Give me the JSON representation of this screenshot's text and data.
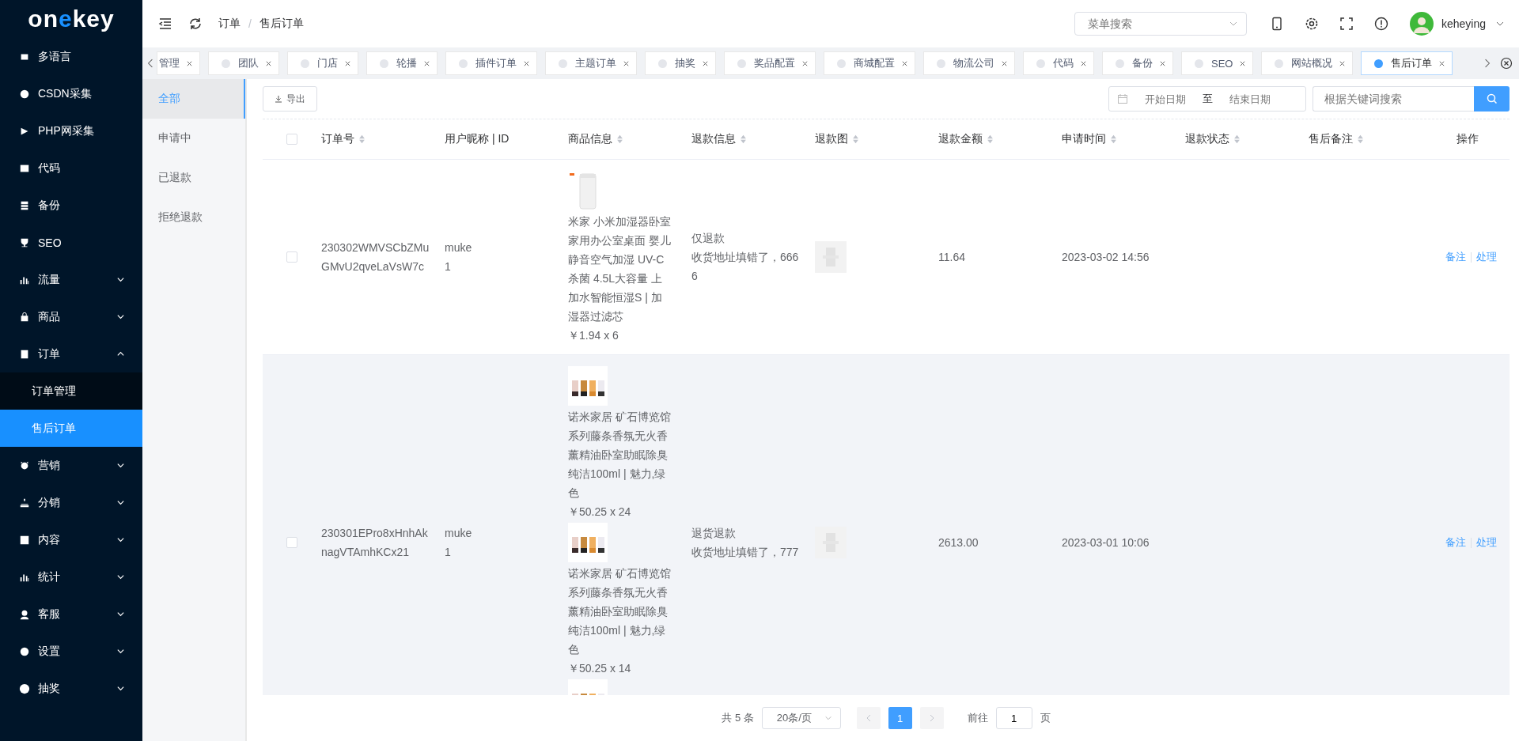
{
  "logo": {
    "text_before": "o",
    "text_mark": "n",
    "text_accent": "e",
    "text_after": "key"
  },
  "sidebar": {
    "items": [
      {
        "label": "多语言",
        "has_arrow": false,
        "selected": false
      },
      {
        "label": "CSDN采集",
        "has_arrow": false,
        "selected": false
      },
      {
        "label": "PHP网采集",
        "has_arrow": false,
        "selected": false
      },
      {
        "label": "代码",
        "has_arrow": false,
        "selected": false
      },
      {
        "label": "备份",
        "has_arrow": false,
        "selected": false
      },
      {
        "label": "SEO",
        "has_arrow": false,
        "selected": false
      },
      {
        "label": "流量",
        "has_arrow": true,
        "expanded": false,
        "selected": false
      },
      {
        "label": "商品",
        "has_arrow": true,
        "expanded": false,
        "selected": false
      },
      {
        "label": "订单",
        "has_arrow": true,
        "expanded": true,
        "selected": false,
        "children": [
          {
            "label": "订单管理",
            "selected": false
          },
          {
            "label": "售后订单",
            "selected": true
          }
        ]
      },
      {
        "label": "营销",
        "has_arrow": true,
        "expanded": false,
        "selected": false
      },
      {
        "label": "分销",
        "has_arrow": true,
        "expanded": false,
        "selected": false
      },
      {
        "label": "内容",
        "has_arrow": true,
        "expanded": false,
        "selected": false
      },
      {
        "label": "统计",
        "has_arrow": true,
        "expanded": false,
        "selected": false
      },
      {
        "label": "客服",
        "has_arrow": true,
        "expanded": false,
        "selected": false
      },
      {
        "label": "设置",
        "has_arrow": true,
        "expanded": false,
        "selected": false
      },
      {
        "label": "抽奖",
        "has_arrow": true,
        "expanded": false,
        "selected": false
      }
    ]
  },
  "header": {
    "breadcrumb": [
      "订单",
      "售后订单"
    ],
    "breadcrumb_separator": "/",
    "menu_search": {
      "placeholder": "菜单搜索"
    },
    "username": "keheying"
  },
  "tabs": [
    {
      "label": "管理",
      "dot": false,
      "selected": false
    },
    {
      "label": "团队",
      "dot": true,
      "selected": false
    },
    {
      "label": "门店",
      "dot": true,
      "selected": false
    },
    {
      "label": "轮播",
      "dot": true,
      "selected": false
    },
    {
      "label": "插件订单",
      "dot": true,
      "selected": false
    },
    {
      "label": "主题订单",
      "dot": true,
      "selected": false
    },
    {
      "label": "抽奖",
      "dot": true,
      "selected": false
    },
    {
      "label": "奖品配置",
      "dot": true,
      "selected": false
    },
    {
      "label": "商城配置",
      "dot": true,
      "selected": false
    },
    {
      "label": "物流公司",
      "dot": true,
      "selected": false
    },
    {
      "label": "代码",
      "dot": true,
      "selected": false
    },
    {
      "label": "备份",
      "dot": true,
      "selected": false
    },
    {
      "label": "SEO",
      "dot": true,
      "selected": false
    },
    {
      "label": "网站概况",
      "dot": true,
      "selected": false
    },
    {
      "label": "售后订单",
      "dot": true,
      "selected": true
    }
  ],
  "status_filter": [
    {
      "label": "全部",
      "selected": true
    },
    {
      "label": "申请中",
      "selected": false
    },
    {
      "label": "已退款",
      "selected": false
    },
    {
      "label": "拒绝退款",
      "selected": false
    }
  ],
  "toolbar": {
    "export_button": "导出",
    "start_date": {
      "placeholder": "开始日期"
    },
    "range_separator": "至",
    "end_date": {
      "placeholder": "结束日期"
    },
    "keyword": {
      "placeholder": "根据关键词搜索"
    }
  },
  "table": {
    "all_checked": false,
    "columns": [
      {
        "label": "订单号",
        "sortable": true
      },
      {
        "label": "用户昵称 | ID",
        "sortable": false
      },
      {
        "label": "商品信息",
        "sortable": true
      },
      {
        "label": "退款信息",
        "sortable": true
      },
      {
        "label": "退款图",
        "sortable": true
      },
      {
        "label": "退款金额",
        "sortable": true
      },
      {
        "label": "申请时间",
        "sortable": true
      },
      {
        "label": "退款状态",
        "sortable": true
      },
      {
        "label": "售后备注",
        "sortable": true
      },
      {
        "label": "操作",
        "sortable": false
      }
    ],
    "rows": [
      {
        "checked": false,
        "highlighted": false,
        "order_no": "230302WMVSCbZMuGMvU2qveLaVsW7c",
        "user_name": "muke",
        "user_id": "1",
        "goods": [
          {
            "kind": "humidifier",
            "name": "米家 小米加湿器卧室家用办公室桌面 婴儿静音空气加湿 UV-C杀菌 4.5L大容量 上加水智能恒湿S | 加湿器过滤芯",
            "price": "￥1.94 x 6"
          }
        ],
        "refund_type": "仅退款",
        "refund_reason": "收货地址填错了，6666",
        "amount": "11.64",
        "time": "2023-03-02 14:56",
        "actions": [
          "备注",
          "处理"
        ]
      },
      {
        "checked": false,
        "highlighted": true,
        "order_no": "230301EPro8xHnhAknagVTAmhKCx21",
        "user_name": "muke",
        "user_id": "1",
        "goods": [
          {
            "kind": "bottles",
            "name": "诺米家居 矿石博览馆系列藤条香氛无火香薰精油卧室助眠除臭纯洁100ml | 魅力,绿色",
            "price": "￥50.25 x 24"
          },
          {
            "kind": "bottles",
            "name": "诺米家居 矿石博览馆系列藤条香氛无火香薰精油卧室助眠除臭纯洁100ml | 魅力,绿色",
            "price": "￥50.25 x 14"
          },
          {
            "kind": "bottles"
          }
        ],
        "refund_type": "退货退款",
        "refund_reason": "收货地址填错了，777",
        "amount": "2613.00",
        "time": "2023-03-01 10:06",
        "actions": [
          "备注",
          "处理"
        ]
      }
    ]
  },
  "pagination": {
    "total": "共 5 条",
    "page_size": "20条/页",
    "pages": [
      {
        "label": "1",
        "selected": true
      }
    ],
    "prev_disabled": true,
    "next_disabled": true,
    "goto_label": "前往",
    "goto_value": "1",
    "goto_suffix": "页"
  }
}
